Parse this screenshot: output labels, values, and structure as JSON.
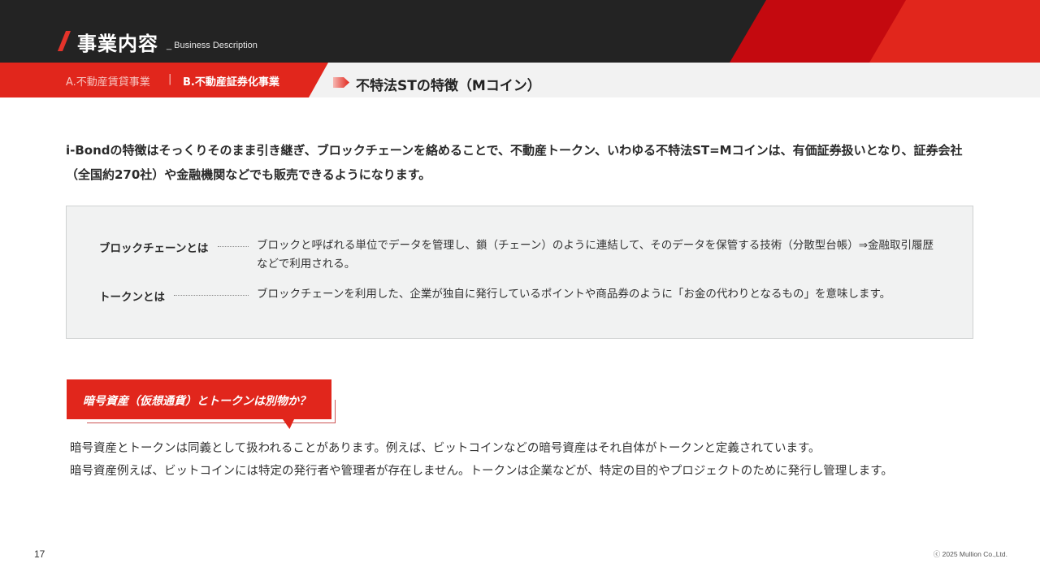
{
  "header": {
    "title": "事業内容",
    "subtitle": "_ Business Description"
  },
  "subnav": {
    "tab_a": "A.不動産賃貸事業",
    "separator": "|",
    "tab_b": "B.不動産証券化事業"
  },
  "section": {
    "title": "不特法STの特徴（Mコイン）"
  },
  "intro": {
    "text": "i-Bondの特徴はそっくりそのまま引き継ぎ、ブロックチェーンを絡めることで、不動産トークン、いわゆる不特法ST=Mコインは、有価証券扱いとなり、証券会社（全国約270社）や金融機関などでも販売できるようになります。"
  },
  "definitions": [
    {
      "term": "ブロックチェーンとは",
      "desc": "ブロックと呼ばれる単位でデータを管理し、鎖（チェーン）のように連結して、そのデータを保管する技術（分散型台帳）⇒金融取引履歴などで利用される。"
    },
    {
      "term": "トークンとは",
      "desc": "ブロックチェーンを利用した、企業が独自に発行しているポイントや商品券のように「お金の代わりとなるもの」を意味します。"
    }
  ],
  "question": {
    "label": "暗号資産（仮想通貨）とトークンは別物か？"
  },
  "answer": {
    "line1": "暗号資産とトークンは同義として扱われることがあります。例えば、ビットコインなどの暗号資産はそれ自体がトークンと定義されています。",
    "line2": "暗号資産例えば、ビットコインには特定の発行者や管理者が存在しません。トークンは企業などが、特定の目的やプロジェクトのために発行し管理します。"
  },
  "footer": {
    "page_number": "17",
    "copyright": "ⓒ 2025 Mullion Co.,Ltd."
  },
  "colors": {
    "accent": "#e1261c",
    "accent_dark": "#c4090f",
    "header_bg": "#232323",
    "box_bg": "#f1f2f2"
  }
}
